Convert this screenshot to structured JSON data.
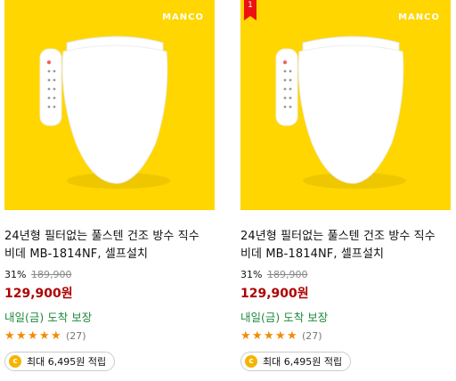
{
  "products": [
    {
      "brand": "MANCO",
      "rank_badge": "",
      "title": "24년형 필터없는 풀스텐 건조 방수 직수 비데 MB-1814NF, 셀프설치",
      "discount": "31%",
      "original_price": "189,900",
      "price": "129,900원",
      "delivery": "내일(금) 도착 보장",
      "rating": 4.5,
      "review_count": "(27)",
      "points": "최대 6,495원 적립"
    },
    {
      "brand": "MANCO",
      "rank_badge": "1",
      "title": "24년형 필터없는 풀스텐 건조 방수 직수 비데 MB-1814NF, 셀프설치",
      "discount": "31%",
      "original_price": "189,900",
      "price": "129,900원",
      "delivery": "내일(금) 도착 보장",
      "rating": 4.5,
      "review_count": "(27)",
      "points": "최대 6,495원 적립"
    }
  ],
  "colors": {
    "image_bg": "#ffd600",
    "price": "#ae0000",
    "delivery": "#1e8a3e",
    "star": "#f28b00"
  },
  "icons": {
    "points": "coin-c-icon"
  }
}
